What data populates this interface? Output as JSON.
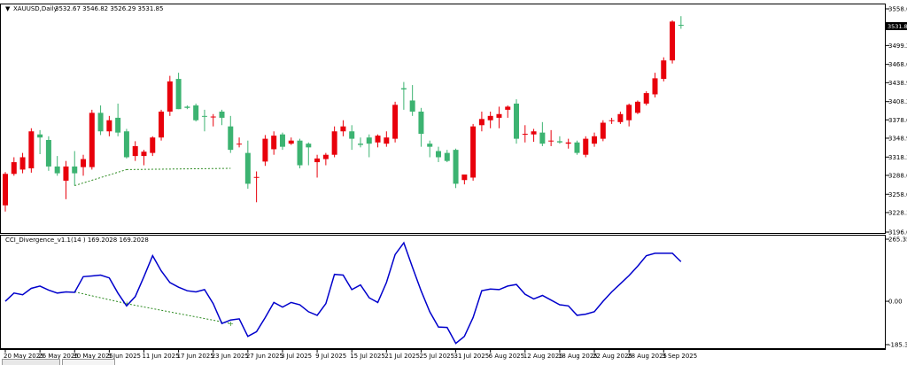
{
  "header": {
    "symbol_label": "XAUUSD,Daily",
    "ohlc_text": "3532.67 3546.82 3526.29 3531.85",
    "menu_glyph": "▼"
  },
  "indicator": {
    "label": "CCI_Divergence_v1.1(14 ) 169.2028 169.2028"
  },
  "colors": {
    "up_candle": "#e8000b",
    "down_candle": "#3cb371",
    "cci_line": "#0000cc",
    "divergence_line": "#2e8b22",
    "axis": "#000000",
    "current_price_bg": "#000000"
  },
  "price_axis": {
    "ticks": [
      "3558.60",
      "3529.00",
      "3499.20",
      "3468.60",
      "3438.90",
      "3408.20",
      "3378.60",
      "3348.90",
      "3318.30",
      "3288.60",
      "3258.00",
      "3228.30",
      "3196.60"
    ],
    "current_price": "3531.85"
  },
  "cci_axis": {
    "ticks": [
      "265.358",
      "0.00",
      "-185.326"
    ]
  },
  "time_axis": {
    "labels": [
      "20 May 2025",
      "26 May 2025",
      "30 May 2025",
      "5 Jun 2025",
      "11 Jun 2025",
      "17 Jun 2025",
      "23 Jun 2025",
      "27 Jun 2025",
      "3 Jul 2025",
      "9 Jul 2025",
      "15 Jul 2025",
      "21 Jul 2025",
      "25 Jul 2025",
      "31 Jul 2025",
      "6 Aug 2025",
      "12 Aug 2025",
      "18 Aug 2025",
      "22 Aug 2025",
      "28 Aug 2025",
      "3 Sep 2025"
    ]
  },
  "chart_data": [
    {
      "type": "candlestick",
      "title": "XAUUSD,Daily",
      "ylim": [
        3196.6,
        3558.6
      ],
      "candles": [
        {
          "o": 3240,
          "h": 3294,
          "l": 3230,
          "c": 3291
        },
        {
          "o": 3291,
          "h": 3318,
          "l": 3288,
          "c": 3310
        },
        {
          "o": 3298,
          "h": 3325,
          "l": 3292,
          "c": 3318
        },
        {
          "o": 3300,
          "h": 3365,
          "l": 3293,
          "c": 3360
        },
        {
          "o": 3355,
          "h": 3362,
          "l": 3323,
          "c": 3350
        },
        {
          "o": 3346,
          "h": 3352,
          "l": 3296,
          "c": 3303
        },
        {
          "o": 3303,
          "h": 3320,
          "l": 3288,
          "c": 3292
        },
        {
          "o": 3280,
          "h": 3312,
          "l": 3250,
          "c": 3303
        },
        {
          "o": 3303,
          "h": 3328,
          "l": 3272,
          "c": 3292
        },
        {
          "o": 3302,
          "h": 3322,
          "l": 3288,
          "c": 3315
        },
        {
          "o": 3302,
          "h": 3395,
          "l": 3298,
          "c": 3390
        },
        {
          "o": 3390,
          "h": 3402,
          "l": 3354,
          "c": 3360
        },
        {
          "o": 3360,
          "h": 3385,
          "l": 3352,
          "c": 3378
        },
        {
          "o": 3382,
          "h": 3405,
          "l": 3352,
          "c": 3358
        },
        {
          "o": 3360,
          "h": 3364,
          "l": 3316,
          "c": 3318
        },
        {
          "o": 3320,
          "h": 3344,
          "l": 3312,
          "c": 3336
        },
        {
          "o": 3320,
          "h": 3330,
          "l": 3305,
          "c": 3327
        },
        {
          "o": 3325,
          "h": 3352,
          "l": 3320,
          "c": 3350
        },
        {
          "o": 3350,
          "h": 3395,
          "l": 3345,
          "c": 3392
        },
        {
          "o": 3392,
          "h": 3450,
          "l": 3385,
          "c": 3441
        },
        {
          "o": 3445,
          "h": 3455,
          "l": 3396,
          "c": 3396
        },
        {
          "o": 3400,
          "h": 3402,
          "l": 3396,
          "c": 3398
        },
        {
          "o": 3402,
          "h": 3405,
          "l": 3376,
          "c": 3378
        },
        {
          "o": 3385,
          "h": 3395,
          "l": 3360,
          "c": 3384
        },
        {
          "o": 3384,
          "h": 3388,
          "l": 3368,
          "c": 3384
        },
        {
          "o": 3392,
          "h": 3395,
          "l": 3370,
          "c": 3382
        },
        {
          "o": 3368,
          "h": 3385,
          "l": 3325,
          "c": 3330
        },
        {
          "o": 3340,
          "h": 3350,
          "l": 3334,
          "c": 3340
        },
        {
          "o": 3325,
          "h": 3345,
          "l": 3267,
          "c": 3275
        },
        {
          "o": 3285,
          "h": 3295,
          "l": 3245,
          "c": 3286
        },
        {
          "o": 3311,
          "h": 3354,
          "l": 3304,
          "c": 3348
        },
        {
          "o": 3331,
          "h": 3360,
          "l": 3322,
          "c": 3353
        },
        {
          "o": 3355,
          "h": 3358,
          "l": 3330,
          "c": 3335
        },
        {
          "o": 3340,
          "h": 3350,
          "l": 3338,
          "c": 3345
        },
        {
          "o": 3345,
          "h": 3348,
          "l": 3300,
          "c": 3305
        },
        {
          "o": 3340,
          "h": 3342,
          "l": 3305,
          "c": 3334
        },
        {
          "o": 3310,
          "h": 3322,
          "l": 3285,
          "c": 3316
        },
        {
          "o": 3315,
          "h": 3325,
          "l": 3305,
          "c": 3322
        },
        {
          "o": 3322,
          "h": 3368,
          "l": 3318,
          "c": 3360
        },
        {
          "o": 3360,
          "h": 3378,
          "l": 3352,
          "c": 3368
        },
        {
          "o": 3360,
          "h": 3370,
          "l": 3330,
          "c": 3348
        },
        {
          "o": 3340,
          "h": 3350,
          "l": 3334,
          "c": 3338
        },
        {
          "o": 3350,
          "h": 3355,
          "l": 3318,
          "c": 3340
        },
        {
          "o": 3342,
          "h": 3355,
          "l": 3334,
          "c": 3353
        },
        {
          "o": 3340,
          "h": 3360,
          "l": 3335,
          "c": 3350
        },
        {
          "o": 3348,
          "h": 3408,
          "l": 3342,
          "c": 3403
        },
        {
          "o": 3430,
          "h": 3440,
          "l": 3395,
          "c": 3428
        },
        {
          "o": 3410,
          "h": 3435,
          "l": 3385,
          "c": 3392
        },
        {
          "o": 3392,
          "h": 3398,
          "l": 3335,
          "c": 3356
        },
        {
          "o": 3340,
          "h": 3345,
          "l": 3318,
          "c": 3335
        },
        {
          "o": 3328,
          "h": 3335,
          "l": 3310,
          "c": 3318
        },
        {
          "o": 3325,
          "h": 3330,
          "l": 3310,
          "c": 3312
        },
        {
          "o": 3330,
          "h": 3332,
          "l": 3268,
          "c": 3275
        },
        {
          "o": 3281,
          "h": 3290,
          "l": 3274,
          "c": 3290
        },
        {
          "o": 3285,
          "h": 3372,
          "l": 3280,
          "c": 3368
        },
        {
          "o": 3370,
          "h": 3392,
          "l": 3360,
          "c": 3380
        },
        {
          "o": 3378,
          "h": 3392,
          "l": 3365,
          "c": 3385
        },
        {
          "o": 3382,
          "h": 3400,
          "l": 3365,
          "c": 3388
        },
        {
          "o": 3395,
          "h": 3402,
          "l": 3382,
          "c": 3400
        },
        {
          "o": 3405,
          "h": 3412,
          "l": 3340,
          "c": 3348
        },
        {
          "o": 3355,
          "h": 3370,
          "l": 3342,
          "c": 3356
        },
        {
          "o": 3355,
          "h": 3364,
          "l": 3343,
          "c": 3360
        },
        {
          "o": 3358,
          "h": 3375,
          "l": 3336,
          "c": 3340
        },
        {
          "o": 3345,
          "h": 3362,
          "l": 3336,
          "c": 3345
        },
        {
          "o": 3344,
          "h": 3352,
          "l": 3340,
          "c": 3342
        },
        {
          "o": 3340,
          "h": 3348,
          "l": 3332,
          "c": 3342
        },
        {
          "o": 3342,
          "h": 3345,
          "l": 3322,
          "c": 3325
        },
        {
          "o": 3322,
          "h": 3352,
          "l": 3318,
          "c": 3348
        },
        {
          "o": 3340,
          "h": 3358,
          "l": 3335,
          "c": 3352
        },
        {
          "o": 3348,
          "h": 3378,
          "l": 3344,
          "c": 3374
        },
        {
          "o": 3378,
          "h": 3382,
          "l": 3372,
          "c": 3378
        },
        {
          "o": 3375,
          "h": 3392,
          "l": 3372,
          "c": 3388
        },
        {
          "o": 3378,
          "h": 3405,
          "l": 3368,
          "c": 3403
        },
        {
          "o": 3390,
          "h": 3410,
          "l": 3388,
          "c": 3408
        },
        {
          "o": 3405,
          "h": 3425,
          "l": 3402,
          "c": 3422
        },
        {
          "o": 3420,
          "h": 3455,
          "l": 3415,
          "c": 3446
        },
        {
          "o": 3445,
          "h": 3480,
          "l": 3441,
          "c": 3475
        },
        {
          "o": 3475,
          "h": 3540,
          "l": 3470,
          "c": 3538
        },
        {
          "o": 3532.67,
          "h": 3546.82,
          "l": 3526.29,
          "c": 3531.85
        }
      ]
    },
    {
      "type": "line",
      "title": "CCI_Divergence_v1.1(14 ) 169.2028 169.2028",
      "ylim": [
        -185.326,
        265.358
      ],
      "series": [
        {
          "values": [
            0,
            35,
            28,
            55,
            65,
            48,
            35,
            40,
            38,
            105,
            108,
            112,
            100,
            35,
            -20,
            20,
            105,
            195,
            130,
            80,
            60,
            45,
            40,
            50,
            -10,
            -95,
            -80,
            -75,
            -150,
            -130,
            -70,
            -5,
            -25,
            -5,
            -15,
            -45,
            -60,
            -10,
            115,
            112,
            50,
            70,
            15,
            -5,
            80,
            200,
            250,
            145,
            45,
            -45,
            -110,
            -112,
            -180,
            -150,
            -70,
            45,
            52,
            50,
            65,
            72,
            30,
            10,
            25,
            5,
            -15,
            -20,
            -60,
            -55,
            -45,
            0,
            40,
            75,
            110,
            150,
            195,
            205,
            205,
            205,
            169.2
          ]
        }
      ]
    }
  ]
}
